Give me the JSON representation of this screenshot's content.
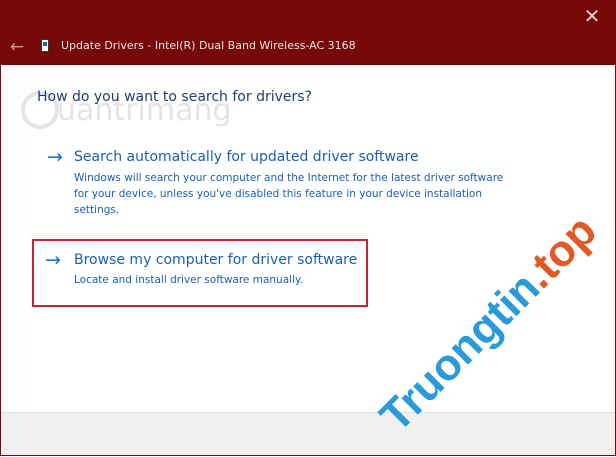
{
  "window": {
    "title": "Update Drivers - Intel(R) Dual Band Wireless-AC 3168",
    "close_label": "✕",
    "back_label": "←"
  },
  "heading": "How do you want to search for drivers?",
  "options": [
    {
      "title": "Search automatically for updated driver software",
      "description": "Windows will search your computer and the Internet for the latest driver software for your device, unless you've disabled this feature in your device installation settings."
    },
    {
      "title": "Browse my computer for driver software",
      "description": "Locate and install driver software manually."
    }
  ],
  "watermarks": {
    "logo_text": "uantrimang",
    "brand_main": "Truongtin",
    "brand_tld": ".top"
  },
  "colors": {
    "titlebar": "#760808",
    "link": "#1a5fb4",
    "highlight_border": "#c2272d"
  }
}
